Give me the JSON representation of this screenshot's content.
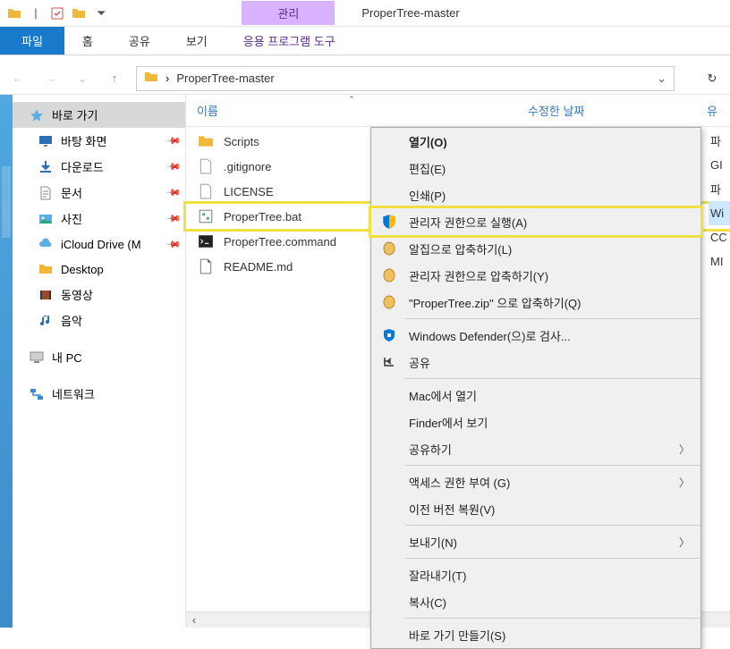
{
  "window": {
    "title": "ProperTree-master",
    "manage_tab": "관리",
    "tools_tab": "응용 프로그램 도구"
  },
  "ribbon": {
    "file": "파일",
    "home": "홈",
    "share": "공유",
    "view": "보기"
  },
  "address": {
    "path": "ProperTree-master"
  },
  "nav": {
    "quick_access": "바로 가기",
    "desktop": "바탕 화면",
    "downloads": "다운로드",
    "documents": "문서",
    "pictures": "사진",
    "icloud": "iCloud Drive (M",
    "desktop2": "Desktop",
    "videos": "동영상",
    "music": "음악",
    "this_pc": "내 PC",
    "network": "네트워크"
  },
  "columns": {
    "name": "이름",
    "date": "수정한 날짜",
    "type": "유"
  },
  "files": [
    {
      "name": "Scripts",
      "icon": "folder",
      "type": "파"
    },
    {
      "name": ".gitignore",
      "icon": "file",
      "type": "GI"
    },
    {
      "name": "LICENSE",
      "icon": "file",
      "type": "파"
    },
    {
      "name": "ProperTree.bat",
      "icon": "bat",
      "type": "Wi",
      "highlighted": true,
      "selected": true
    },
    {
      "name": "ProperTree.command",
      "icon": "cmd",
      "type": "CC"
    },
    {
      "name": "README.md",
      "icon": "md",
      "type": "MI"
    }
  ],
  "menu": {
    "open": "열기(O)",
    "edit": "편집(E)",
    "print": "인쇄(P)",
    "run_as_admin": "관리자 권한으로 실행(A)",
    "alzip": "알집으로 압축하기(L)",
    "alzip_admin": "관리자 권한으로 압축하기(Y)",
    "alzip_zip": "\"ProperTree.zip\" 으로 압축하기(Q)",
    "defender": "Windows Defender(으)로 검사...",
    "share": "공유",
    "mac_open": "Mac에서 열기",
    "finder": "Finder에서 보기",
    "share2": "공유하기",
    "access": "액세스 권한 부여 (G)",
    "restore": "이전 버전 복원(V)",
    "sendto": "보내기(N)",
    "cut": "잘라내기(T)",
    "copy": "복사(C)",
    "shortcut": "바로 가기 만들기(S)"
  }
}
